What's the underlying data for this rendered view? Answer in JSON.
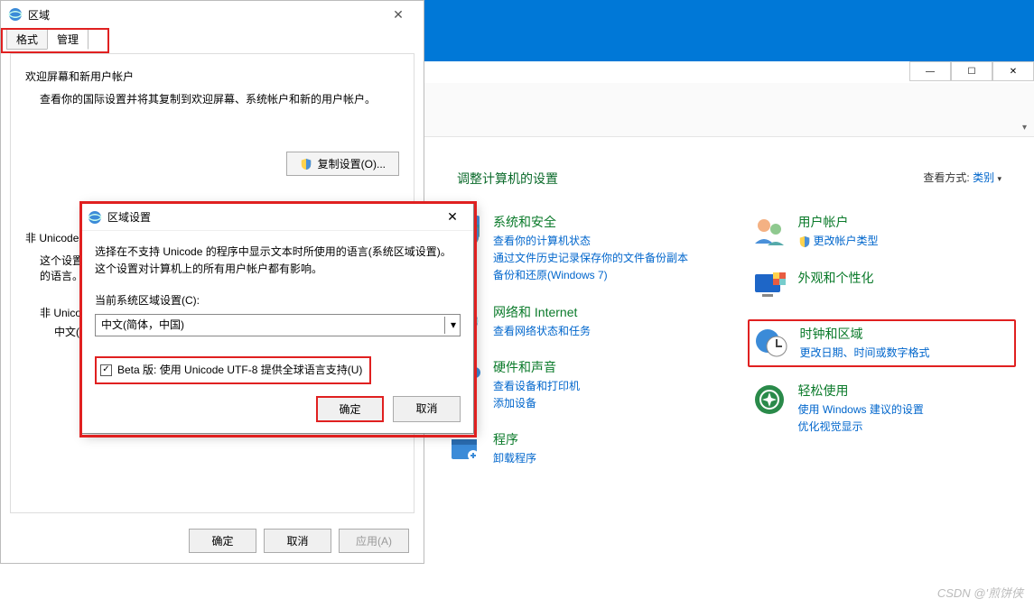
{
  "desktop": {},
  "explorer": {
    "window_controls": {
      "minimize": "—",
      "maximize": "☐",
      "close": "✕"
    },
    "address_bar_dd": "",
    "cp": {
      "heading": "调整计算机的设置",
      "view_label": "查看方式:",
      "view_value": "类别",
      "columns": [
        [
          {
            "icon": "shield-icon",
            "title": "系统和安全",
            "links": [
              "查看你的计算机状态",
              "通过文件历史记录保存你的文件备份副本",
              "备份和还原(Windows 7)"
            ]
          },
          {
            "icon": "network-icon",
            "title": "网络和 Internet",
            "links": [
              "查看网络状态和任务"
            ]
          },
          {
            "icon": "hardware-icon",
            "title": "硬件和声音",
            "links": [
              "查看设备和打印机",
              "添加设备"
            ]
          },
          {
            "icon": "programs-icon",
            "title": "程序",
            "links": [
              "卸载程序"
            ]
          }
        ],
        [
          {
            "icon": "users-icon",
            "title": "用户帐户",
            "links": [
              "更改帐户类型"
            ]
          },
          {
            "icon": "appearance-icon",
            "title": "外观和个性化",
            "links": []
          },
          {
            "icon": "clock-icon",
            "title": "时钟和区域",
            "links": [
              "更改日期、时间或数字格式"
            ],
            "highlighted": true
          },
          {
            "icon": "ease-icon",
            "title": "轻松使用",
            "links": [
              "使用 Windows 建议的设置",
              "优化视觉显示"
            ]
          }
        ]
      ]
    }
  },
  "region_dialog": {
    "title": "区域",
    "close": "✕",
    "tabs": {
      "format": "格式",
      "admin": "管理"
    },
    "welcome": {
      "title": "欢迎屏幕和新用户帐户",
      "desc": "查看你的国际设置并将其复制到欢迎屏幕、系统帐户和新的用户帐户。",
      "copy_btn": "复制设置(O)..."
    },
    "nonunicode": {
      "title": "非 Unicode 程序的语言",
      "desc_line1": "这个设置(系统区域设置)控制在不支持 Unicode 的程序中显示文本时所使用的语言。",
      "desc_line2": "非 Unicode 程序中所使用的当前语言:",
      "current": "中文(简体，中国)"
    },
    "footer": {
      "ok": "确定",
      "cancel": "取消",
      "apply": "应用(A)"
    }
  },
  "locale_dialog": {
    "title": "区域设置",
    "close": "✕",
    "desc": "选择在不支持 Unicode 的程序中显示文本时所使用的语言(系统区域设置)。这个设置对计算机上的所有用户帐户都有影响。",
    "current_label": "当前系统区域设置(C):",
    "current_value": "中文(简体，中国)",
    "beta_checkbox": "Beta 版: 使用 Unicode UTF-8 提供全球语言支持(U)",
    "beta_checked": true,
    "ok": "确定",
    "cancel": "取消"
  },
  "watermark": "CSDN @'煎饼侠"
}
